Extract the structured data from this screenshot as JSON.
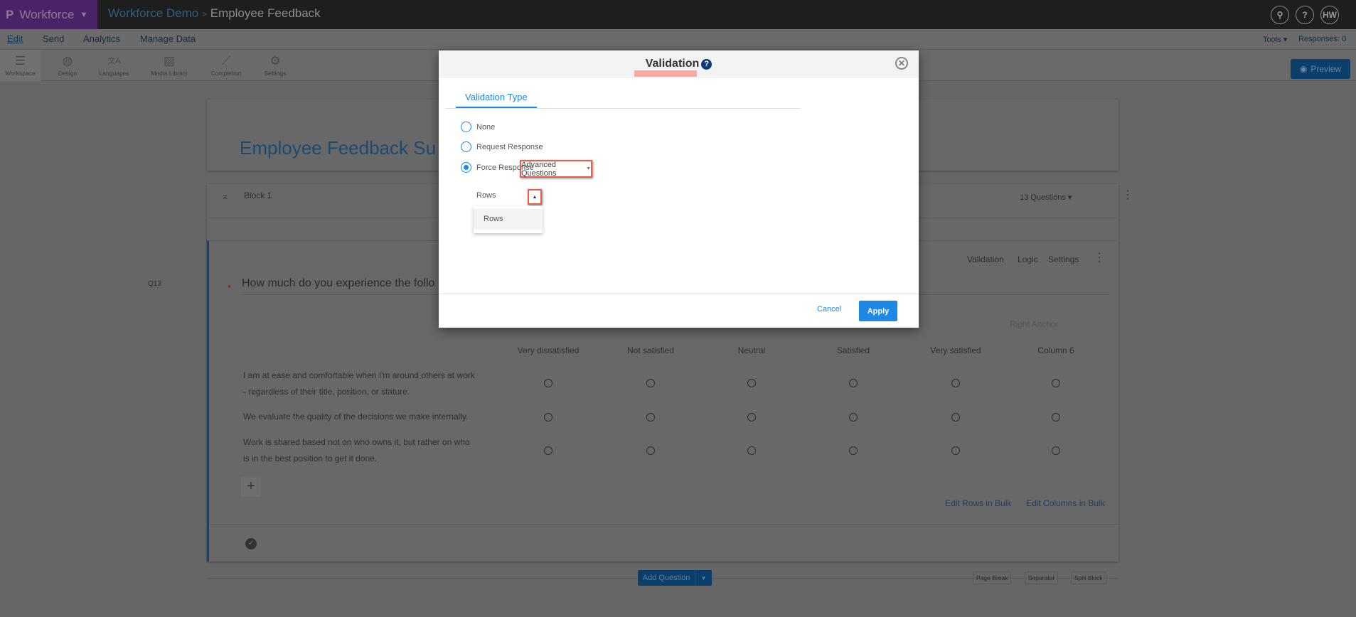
{
  "topbar": {
    "brand": "Workforce",
    "crumb_project": "Workforce Demo",
    "crumb_sep": ">",
    "crumb_page": "Employee Feedback",
    "avatar": "HW"
  },
  "nav": {
    "items": [
      "Edit",
      "Send",
      "Analytics",
      "Manage Data"
    ],
    "tools": "Tools ▾",
    "responses": "Responses: 0"
  },
  "toolbar": {
    "items": [
      "Workspace",
      "Design",
      "Languages",
      "Media Library",
      "Completion",
      "Settings"
    ],
    "preview": "Preview"
  },
  "survey": {
    "title": "Employee Feedback Su",
    "block_name": "Block 1",
    "question_count": "13 Questions",
    "question": {
      "id": "Q13",
      "required_mark": "*",
      "text": "How much do you experience the follo",
      "actions": [
        "Validation",
        "Logic",
        "Settings"
      ],
      "right_anchor": "Right Anchor",
      "columns": [
        "Very dissatisfied",
        "Not satisfied",
        "Neutral",
        "Satisfied",
        "Very satisfied",
        "Column 6"
      ],
      "rows": [
        "I am at ease and comfortable when I'm around others at work - regardless of their title, position, or stature.",
        "We evaluate the quality of the decisions we make internally.",
        "Work is shared based not on who owns it, but rather on who is in the best position to get it done."
      ],
      "edit_rows": "Edit Rows in Bulk",
      "edit_columns": "Edit Columns in Bulk"
    },
    "add_question": "Add Question",
    "page_break": "Page Break",
    "separator": "Separator",
    "split_block": "Split Block"
  },
  "modal": {
    "title": "Validation",
    "help": "?",
    "tab": "Validation Type",
    "options": [
      "None",
      "Request Response",
      "Force Response"
    ],
    "selected": "Force Response",
    "advanced_dropdown": "Advanced Questions",
    "rows_label": "Rows",
    "rows_menu": [
      "Rows"
    ],
    "cancel": "Cancel",
    "apply": "Apply"
  }
}
